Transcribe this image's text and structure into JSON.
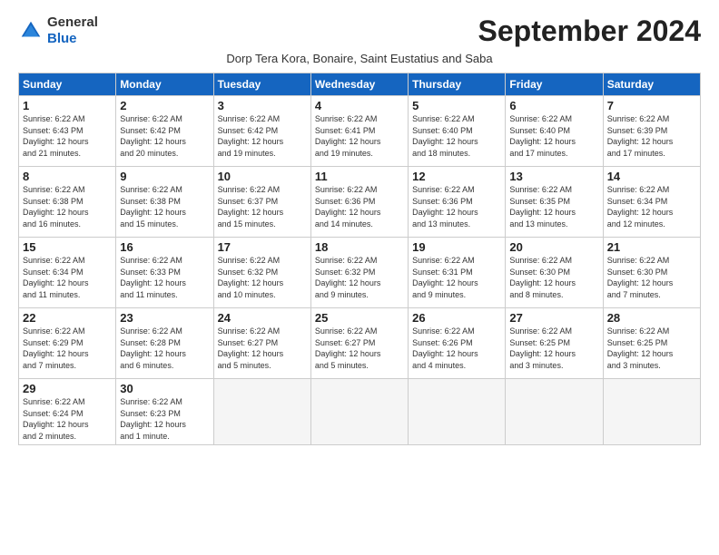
{
  "logo": {
    "general": "General",
    "blue": "Blue"
  },
  "title": "September 2024",
  "subtitle": "Dorp Tera Kora, Bonaire, Saint Eustatius and Saba",
  "headers": [
    "Sunday",
    "Monday",
    "Tuesday",
    "Wednesday",
    "Thursday",
    "Friday",
    "Saturday"
  ],
  "days": [
    {
      "num": "",
      "info": ""
    },
    {
      "num": "2",
      "info": "Sunrise: 6:22 AM\nSunset: 6:42 PM\nDaylight: 12 hours\nand 20 minutes."
    },
    {
      "num": "3",
      "info": "Sunrise: 6:22 AM\nSunset: 6:42 PM\nDaylight: 12 hours\nand 19 minutes."
    },
    {
      "num": "4",
      "info": "Sunrise: 6:22 AM\nSunset: 6:41 PM\nDaylight: 12 hours\nand 19 minutes."
    },
    {
      "num": "5",
      "info": "Sunrise: 6:22 AM\nSunset: 6:40 PM\nDaylight: 12 hours\nand 18 minutes."
    },
    {
      "num": "6",
      "info": "Sunrise: 6:22 AM\nSunset: 6:40 PM\nDaylight: 12 hours\nand 17 minutes."
    },
    {
      "num": "7",
      "info": "Sunrise: 6:22 AM\nSunset: 6:39 PM\nDaylight: 12 hours\nand 17 minutes."
    },
    {
      "num": "8",
      "info": "Sunrise: 6:22 AM\nSunset: 6:38 PM\nDaylight: 12 hours\nand 16 minutes."
    },
    {
      "num": "9",
      "info": "Sunrise: 6:22 AM\nSunset: 6:38 PM\nDaylight: 12 hours\nand 15 minutes."
    },
    {
      "num": "10",
      "info": "Sunrise: 6:22 AM\nSunset: 6:37 PM\nDaylight: 12 hours\nand 15 minutes."
    },
    {
      "num": "11",
      "info": "Sunrise: 6:22 AM\nSunset: 6:36 PM\nDaylight: 12 hours\nand 14 minutes."
    },
    {
      "num": "12",
      "info": "Sunrise: 6:22 AM\nSunset: 6:36 PM\nDaylight: 12 hours\nand 13 minutes."
    },
    {
      "num": "13",
      "info": "Sunrise: 6:22 AM\nSunset: 6:35 PM\nDaylight: 12 hours\nand 13 minutes."
    },
    {
      "num": "14",
      "info": "Sunrise: 6:22 AM\nSunset: 6:34 PM\nDaylight: 12 hours\nand 12 minutes."
    },
    {
      "num": "15",
      "info": "Sunrise: 6:22 AM\nSunset: 6:34 PM\nDaylight: 12 hours\nand 11 minutes."
    },
    {
      "num": "16",
      "info": "Sunrise: 6:22 AM\nSunset: 6:33 PM\nDaylight: 12 hours\nand 11 minutes."
    },
    {
      "num": "17",
      "info": "Sunrise: 6:22 AM\nSunset: 6:32 PM\nDaylight: 12 hours\nand 10 minutes."
    },
    {
      "num": "18",
      "info": "Sunrise: 6:22 AM\nSunset: 6:32 PM\nDaylight: 12 hours\nand 9 minutes."
    },
    {
      "num": "19",
      "info": "Sunrise: 6:22 AM\nSunset: 6:31 PM\nDaylight: 12 hours\nand 9 minutes."
    },
    {
      "num": "20",
      "info": "Sunrise: 6:22 AM\nSunset: 6:30 PM\nDaylight: 12 hours\nand 8 minutes."
    },
    {
      "num": "21",
      "info": "Sunrise: 6:22 AM\nSunset: 6:30 PM\nDaylight: 12 hours\nand 7 minutes."
    },
    {
      "num": "22",
      "info": "Sunrise: 6:22 AM\nSunset: 6:29 PM\nDaylight: 12 hours\nand 7 minutes."
    },
    {
      "num": "23",
      "info": "Sunrise: 6:22 AM\nSunset: 6:28 PM\nDaylight: 12 hours\nand 6 minutes."
    },
    {
      "num": "24",
      "info": "Sunrise: 6:22 AM\nSunset: 6:27 PM\nDaylight: 12 hours\nand 5 minutes."
    },
    {
      "num": "25",
      "info": "Sunrise: 6:22 AM\nSunset: 6:27 PM\nDaylight: 12 hours\nand 5 minutes."
    },
    {
      "num": "26",
      "info": "Sunrise: 6:22 AM\nSunset: 6:26 PM\nDaylight: 12 hours\nand 4 minutes."
    },
    {
      "num": "27",
      "info": "Sunrise: 6:22 AM\nSunset: 6:25 PM\nDaylight: 12 hours\nand 3 minutes."
    },
    {
      "num": "28",
      "info": "Sunrise: 6:22 AM\nSunset: 6:25 PM\nDaylight: 12 hours\nand 3 minutes."
    },
    {
      "num": "29",
      "info": "Sunrise: 6:22 AM\nSunset: 6:24 PM\nDaylight: 12 hours\nand 2 minutes."
    },
    {
      "num": "30",
      "info": "Sunrise: 6:22 AM\nSunset: 6:23 PM\nDaylight: 12 hours\nand 1 minute."
    }
  ],
  "day1": {
    "num": "1",
    "info": "Sunrise: 6:22 AM\nSunset: 6:43 PM\nDaylight: 12 hours\nand 21 minutes."
  }
}
